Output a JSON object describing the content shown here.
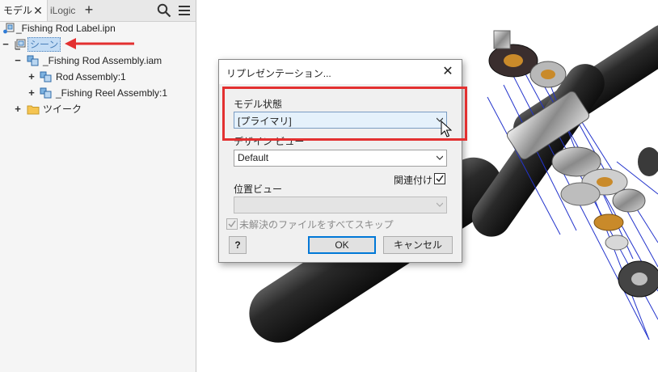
{
  "browser": {
    "tabs": {
      "model": "モデル",
      "ilogic": "iLogic",
      "close": "✕",
      "add": "+"
    },
    "tree": {
      "root": "_Fishing Rod Label.ipn",
      "scene": "シーン",
      "assembly": "_Fishing Rod Assembly.iam",
      "rod": "Rod Assembly:1",
      "reel": "_Fishing Reel Assembly:1",
      "tweaks": "ツイーク"
    },
    "expanders": {
      "collapse": "−",
      "expand": "+"
    }
  },
  "dialog": {
    "title": "リプレゼンテーション...",
    "close": "✕",
    "model_state_label": "モデル状態",
    "model_state_value": "[プライマリ]",
    "design_view_label": "デザイン ビュー",
    "design_view_value": "Default",
    "associative_label": "関連付け",
    "positional_label": "位置ビュー",
    "positional_value": "",
    "skip_label": "未解決のファイルをすべてスキップ",
    "help": "?",
    "ok": "OK",
    "cancel": "キャンセル"
  },
  "colors": {
    "highlight": "#e33030",
    "accent": "#0078d7",
    "selection": "#c3dcf5"
  },
  "icons": [
    "search-icon",
    "menu-icon",
    "presentation-file-icon",
    "scene-icon",
    "assembly-icon",
    "folder-icon",
    "chevron-down-icon",
    "checkbox-icon",
    "mouse-cursor-icon"
  ]
}
